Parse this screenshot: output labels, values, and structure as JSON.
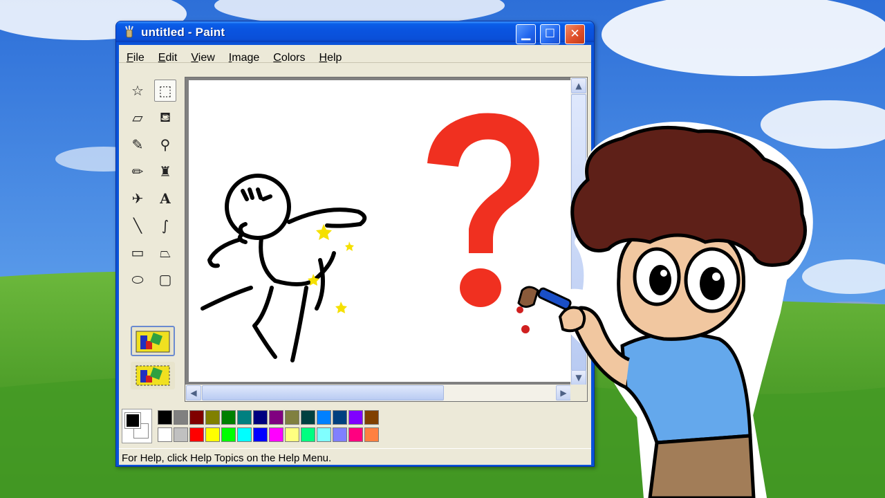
{
  "window": {
    "title": "untitled - Paint",
    "minimize_label": "▁",
    "maximize_label": "☐",
    "close_label": "✕"
  },
  "menu": [
    {
      "label": "File",
      "underline": "F",
      "rest": "ile"
    },
    {
      "label": "Edit",
      "underline": "E",
      "rest": "dit"
    },
    {
      "label": "View",
      "underline": "V",
      "rest": "iew"
    },
    {
      "label": "Image",
      "underline": "I",
      "rest": "mage"
    },
    {
      "label": "Colors",
      "underline": "C",
      "rest": "olors"
    },
    {
      "label": "Help",
      "underline": "H",
      "rest": "elp"
    }
  ],
  "tools": [
    {
      "name": "free-form-select-icon",
      "glyph": "☆"
    },
    {
      "name": "rectangle-select-icon",
      "glyph": "⬚",
      "active": true
    },
    {
      "name": "eraser-icon",
      "glyph": "▱"
    },
    {
      "name": "fill-bucket-icon",
      "glyph": "⛾"
    },
    {
      "name": "color-picker-icon",
      "glyph": "✎"
    },
    {
      "name": "magnifier-icon",
      "glyph": "⚲"
    },
    {
      "name": "pencil-icon",
      "glyph": "✏"
    },
    {
      "name": "brush-icon",
      "glyph": "♜"
    },
    {
      "name": "airbrush-icon",
      "glyph": "✈"
    },
    {
      "name": "text-icon",
      "glyph": "A"
    },
    {
      "name": "line-icon",
      "glyph": "╲"
    },
    {
      "name": "curve-icon",
      "glyph": "∫"
    },
    {
      "name": "rectangle-icon",
      "glyph": "▭"
    },
    {
      "name": "polygon-icon",
      "glyph": "⏢"
    },
    {
      "name": "ellipse-icon",
      "glyph": "⬭"
    },
    {
      "name": "rounded-rectangle-icon",
      "glyph": "▢"
    }
  ],
  "palette": {
    "foreground": "#000000",
    "background": "#ffffff",
    "row1": [
      "#000000",
      "#808080",
      "#800000",
      "#808000",
      "#008000",
      "#008080",
      "#000080",
      "#800080",
      "#808040",
      "#004040",
      "#0080ff",
      "#004080",
      "#8000ff",
      "#804000"
    ],
    "row2": [
      "#ffffff",
      "#c0c0c0",
      "#ff0000",
      "#ffff00",
      "#00ff00",
      "#00ffff",
      "#0000ff",
      "#ff00ff",
      "#ffff80",
      "#00ff80",
      "#80ffff",
      "#8080ff",
      "#ff0080",
      "#ff8040"
    ]
  },
  "status": {
    "text": "For Help, click Help Topics on the Help Menu."
  },
  "colors": {
    "titlebar": "#0a54e0",
    "question_mark": "#f03020",
    "star": "#f5e000"
  }
}
